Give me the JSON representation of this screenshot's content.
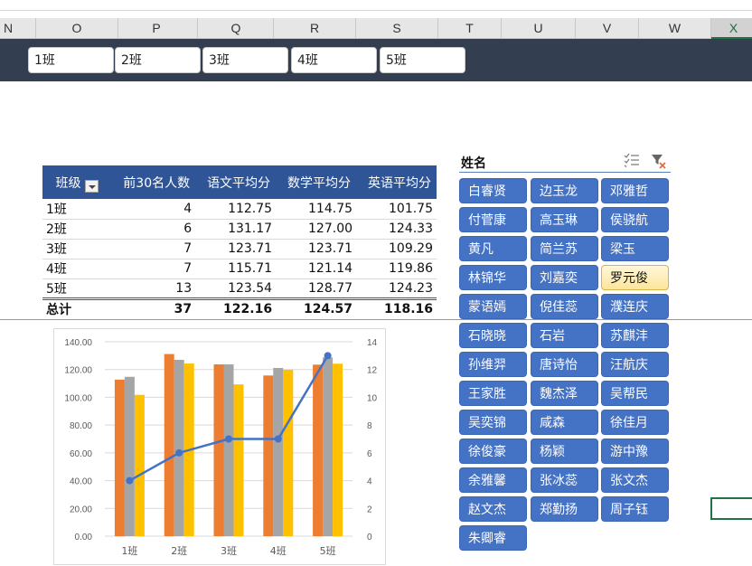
{
  "column_headers": [
    "N",
    "O",
    "P",
    "Q",
    "R",
    "S",
    "T",
    "U",
    "V",
    "W",
    "X"
  ],
  "selected_column": "X",
  "class_buttons": [
    "1班",
    "2班",
    "3班",
    "4班",
    "5班"
  ],
  "pivot": {
    "headers": [
      "班级",
      "前30名人数",
      "语文平均分",
      "数学平均分",
      "英语平均分"
    ],
    "rows": [
      [
        "1班",
        "4",
        "112.75",
        "114.75",
        "101.75"
      ],
      [
        "2班",
        "6",
        "131.17",
        "127.00",
        "124.33"
      ],
      [
        "3班",
        "7",
        "123.71",
        "123.71",
        "109.29"
      ],
      [
        "4班",
        "7",
        "115.71",
        "121.14",
        "119.86"
      ],
      [
        "5班",
        "13",
        "123.54",
        "128.77",
        "124.23"
      ]
    ],
    "total": [
      "总计",
      "37",
      "122.16",
      "124.57",
      "118.16"
    ]
  },
  "slicer": {
    "title": "姓名",
    "multi_select_icon": "multi-select-icon",
    "clear_filter_icon": "clear-filter-icon",
    "items": [
      "白睿贤",
      "边玉龙",
      "邓雅哲",
      "付菅康",
      "高玉琳",
      "侯骁航",
      "黄凡",
      "简兰苏",
      "梁玉",
      "林锦华",
      "刘嘉奕",
      "罗元俊",
      "蒙语嫣",
      "倪佳蕊",
      "濮连庆",
      "石晓晓",
      "石岩",
      "苏麒沣",
      "孙维羿",
      "唐诗怡",
      "汪航庆",
      "王家胜",
      "魏杰泽",
      "吴帮民",
      "吴奕锦",
      "咸森",
      "徐佳月",
      "徐俊豪",
      "杨颖",
      "游中豫",
      "余雅馨",
      "张冰蕊",
      "张文杰",
      "赵文杰",
      "郑勤扬",
      "周子钰",
      "朱卿睿"
    ],
    "selected": "罗元俊",
    "colors": {
      "item": "#4472c4",
      "selected": "#fde59a"
    }
  },
  "chart_data": {
    "type": "bar",
    "categories": [
      "1班",
      "2班",
      "3班",
      "4班",
      "5班"
    ],
    "series": [
      {
        "name": "语文平均分",
        "kind": "bar",
        "axis": "left",
        "color": "#ed7d31",
        "values": [
          112.75,
          131.17,
          123.71,
          115.71,
          123.54
        ]
      },
      {
        "name": "数学平均分",
        "kind": "bar",
        "axis": "left",
        "color": "#a5a5a5",
        "values": [
          114.75,
          127.0,
          123.71,
          121.14,
          128.77
        ]
      },
      {
        "name": "英语平均分",
        "kind": "bar",
        "axis": "left",
        "color": "#ffc000",
        "values": [
          101.75,
          124.33,
          109.29,
          119.86,
          124.23
        ]
      },
      {
        "name": "前30名人数",
        "kind": "line",
        "axis": "right",
        "color": "#4472c4",
        "values": [
          4,
          6,
          7,
          7,
          13
        ]
      }
    ],
    "y_left": {
      "range": [
        0,
        140
      ],
      "ticks": [
        "0.00",
        "20.00",
        "40.00",
        "60.00",
        "80.00",
        "100.00",
        "120.00",
        "140.00"
      ]
    },
    "y_right": {
      "range": [
        0,
        14
      ],
      "ticks": [
        "0",
        "2",
        "4",
        "6",
        "8",
        "10",
        "12",
        "14"
      ]
    },
    "grid": true,
    "title": "",
    "legend": "none"
  }
}
